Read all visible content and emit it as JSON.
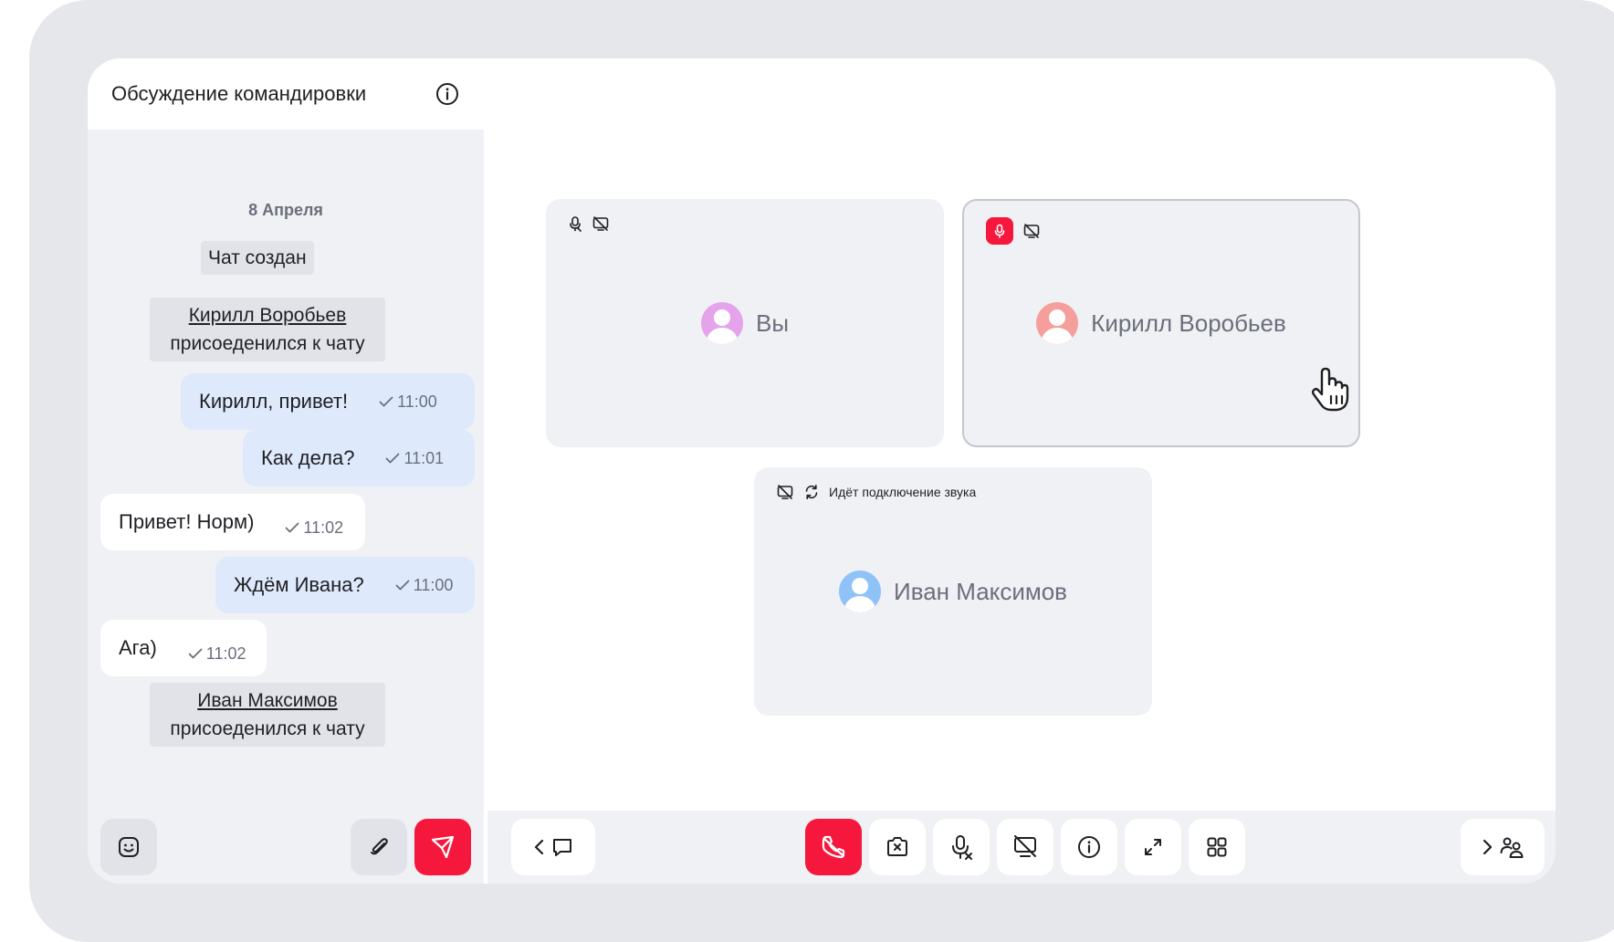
{
  "chat": {
    "title": "Обсуждение командировки",
    "date": "8 Апреля",
    "system": {
      "created": "Чат создан",
      "joined_1_name": "Кирилл Воробьев",
      "joined_1_text": "присоеденился к чату",
      "joined_2_name": "Иван Максимов",
      "joined_2_text": "присоеденился к чату"
    },
    "messages": [
      {
        "text": "Кирилл, привет!",
        "time": "11:00"
      },
      {
        "text": "Как дела?",
        "time": "11:01"
      },
      {
        "text": "Привет! Норм)",
        "time": "11:02"
      },
      {
        "text": "Ждём Ивана?",
        "time": "11:00"
      },
      {
        "text": "Ага)",
        "time": "11:02"
      }
    ]
  },
  "participants": [
    {
      "name": "Вы",
      "avatar_color": "#e5a3ec"
    },
    {
      "name": "Кирилл Воробьев",
      "avatar_color": "#f59f9c"
    },
    {
      "name": "Иван Максимов",
      "avatar_color": "#8fc2f7",
      "status": "Идёт подключение звука"
    }
  ],
  "colors": {
    "accent_red": "#f5183c",
    "outgoing_bubble": "#deeafc",
    "panel_bg": "#f0f1f5"
  },
  "toolbar": {
    "icons": [
      "chevron-left-icon",
      "chat-icon",
      "hangup-icon",
      "camera-off-icon",
      "mic-muted-icon",
      "screen-share-off-icon",
      "info-icon",
      "expand-icon",
      "grid-icon",
      "chevron-right-icon",
      "participants-icon"
    ]
  }
}
